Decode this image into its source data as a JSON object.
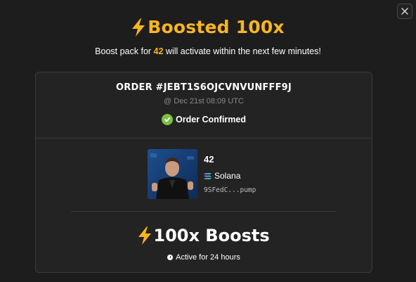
{
  "modal": {
    "close_icon": "close-icon",
    "title": "Boosted 100x",
    "subtitle_prefix": "Boost pack for ",
    "subtitle_token": "42",
    "subtitle_suffix": " will activate within the next few minutes!",
    "accent_color": "#f7b521"
  },
  "order": {
    "id_label": "ORDER #JEBT1S6OJCVNVUNFFF9J",
    "timestamp": "@ Dec 21st 08:09 UTC",
    "status": "Order Confirmed",
    "status_color": "#7ac143"
  },
  "token": {
    "name": "42",
    "chain": "Solana",
    "chain_icon": "solana-icon",
    "address": "9SFedC...pump"
  },
  "boost": {
    "label": "100x Boosts",
    "duration": "Active for 24 hours",
    "duration_icon": "clock-icon"
  }
}
